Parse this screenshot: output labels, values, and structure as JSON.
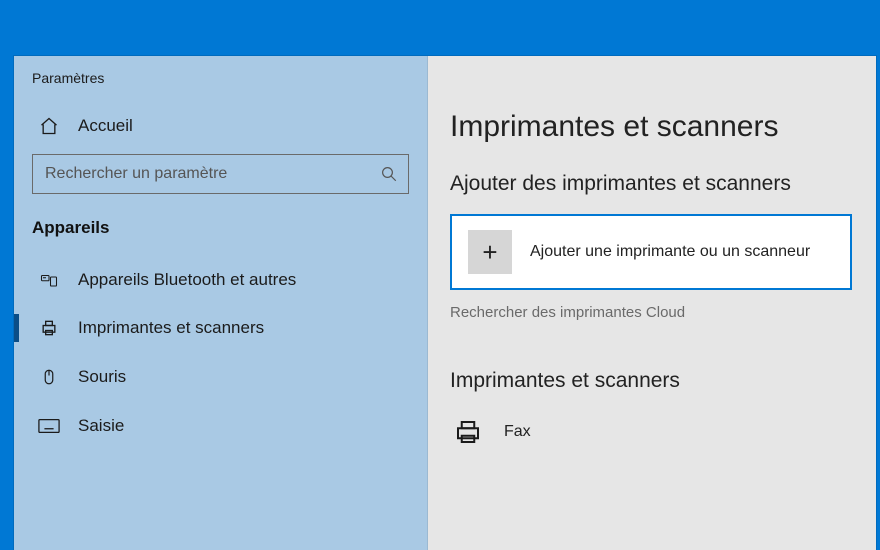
{
  "window": {
    "title": "Paramètres"
  },
  "sidebar": {
    "home": "Accueil",
    "search_placeholder": "Rechercher un paramètre",
    "category": "Appareils",
    "items": [
      {
        "label": "Appareils Bluetooth et autres"
      },
      {
        "label": "Imprimantes et scanners"
      },
      {
        "label": "Souris"
      },
      {
        "label": "Saisie"
      }
    ]
  },
  "content": {
    "h1": "Imprimantes et scanners",
    "h2_add": "Ajouter des imprimantes et scanners",
    "add_label": "Ajouter une imprimante ou un scanneur",
    "cloud_link": "Rechercher des imprimantes Cloud",
    "h2_list": "Imprimantes et scanners",
    "devices": [
      {
        "label": "Fax"
      }
    ]
  }
}
